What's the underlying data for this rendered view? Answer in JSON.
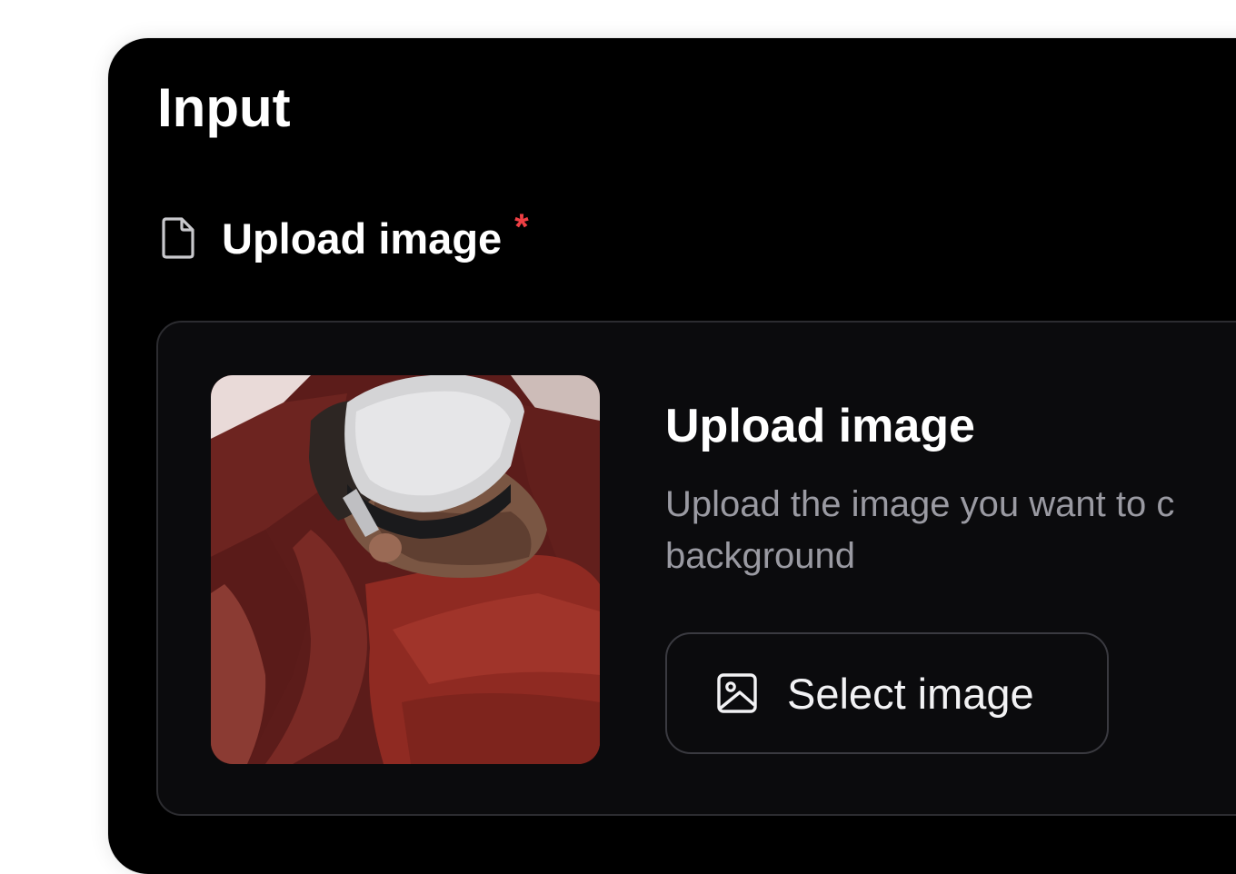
{
  "panel": {
    "title": "Input"
  },
  "field": {
    "label": "Upload image",
    "required_mark": "*",
    "icon": "file-icon"
  },
  "upload_card": {
    "title": "Upload image",
    "description": "Upload the image you want to c\nbackground",
    "preview_alt": "Uploaded photo preview",
    "select_button": {
      "label": "Select image",
      "icon": "image-icon"
    }
  },
  "colors": {
    "panel_background": "#000000",
    "card_background": "#0b0b0d",
    "required": "#ef3f44",
    "muted_text": "#9a9aa2"
  }
}
